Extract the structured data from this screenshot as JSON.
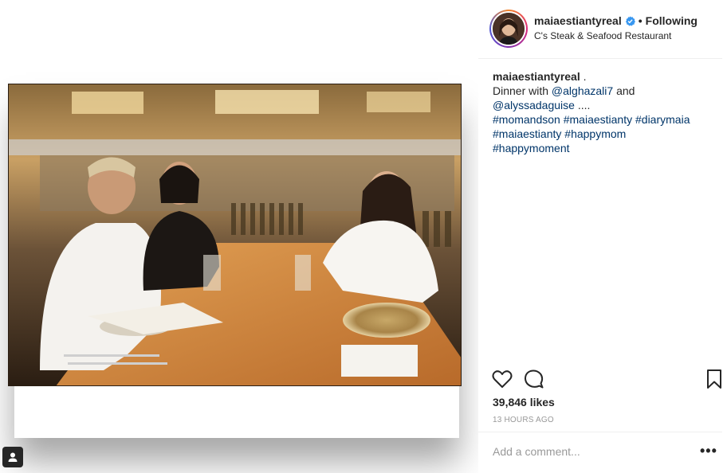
{
  "post": {
    "username": "maiaestiantyreal",
    "separator": "•",
    "follow_state": "Following",
    "location": "C's Steak & Seafood Restaurant",
    "caption": {
      "user": "maiaestiantyreal",
      "line1_suffix": ".",
      "text_before_mention": "Dinner with",
      "mention1": "@alghazali7",
      "text_and": "and",
      "mention2": "@alyssadaguise",
      "ellipsis": "....",
      "hashtags": [
        "#momandson",
        "#maiaestianty",
        "#diarymaia",
        "#maiaestianty",
        "#happymom",
        "#happymoment"
      ]
    },
    "likes": "39,846 likes",
    "timestamp": "13 HOURS AGO",
    "comment_placeholder": "Add a comment...",
    "more_label": "•••"
  },
  "icons": {
    "heart": "heart-icon",
    "comment": "comment-icon",
    "bookmark": "bookmark-icon",
    "verified": "verified-badge-icon",
    "tagged_user": "tagged-user-icon"
  },
  "colors": {
    "link": "#003569",
    "verified": "#3897f0",
    "muted": "#999999",
    "text": "#262626"
  }
}
